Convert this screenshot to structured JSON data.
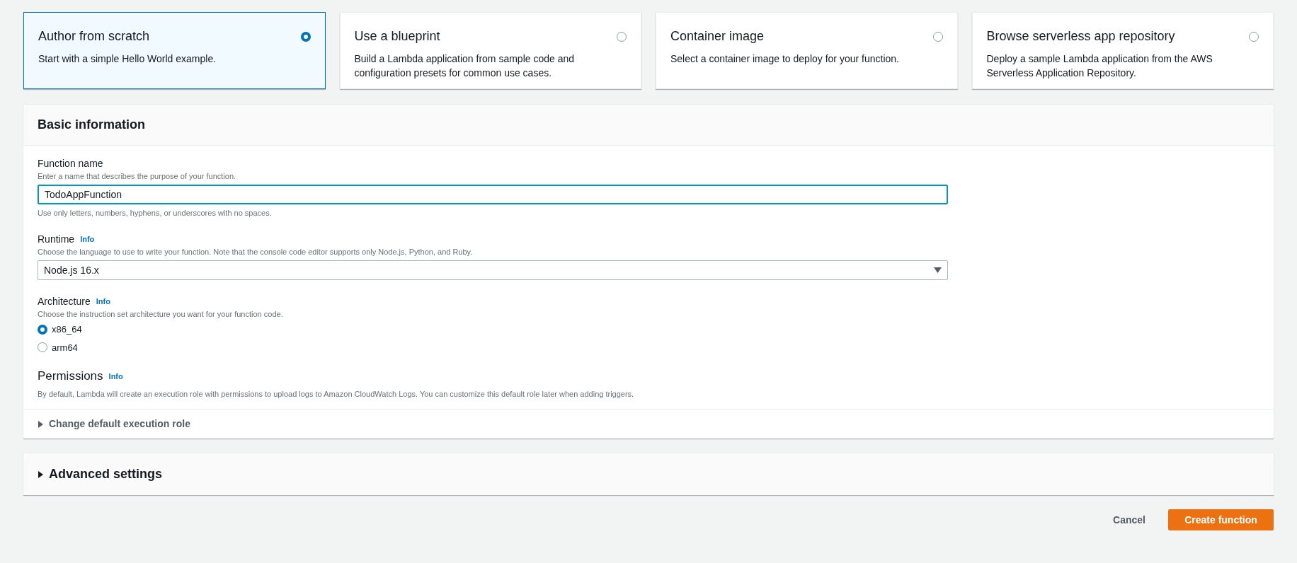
{
  "options": [
    {
      "title": "Author from scratch",
      "description": "Start with a simple Hello World example.",
      "selected": true
    },
    {
      "title": "Use a blueprint",
      "description": "Build a Lambda application from sample code and configuration presets for common use cases.",
      "selected": false
    },
    {
      "title": "Container image",
      "description": "Select a container image to deploy for your function.",
      "selected": false
    },
    {
      "title": "Browse serverless app repository",
      "description": "Deploy a sample Lambda application from the AWS Serverless Application Repository.",
      "selected": false
    }
  ],
  "basic_information": {
    "title": "Basic information",
    "function_name": {
      "label": "Function name",
      "description": "Enter a name that describes the purpose of your function.",
      "value": "TodoAppFunction",
      "hint": "Use only letters, numbers, hyphens, or underscores with no spaces."
    },
    "runtime": {
      "label": "Runtime",
      "info": "Info",
      "description": "Choose the language to use to write your function. Note that the console code editor supports only Node.js, Python, and Ruby.",
      "value": "Node.js 16.x"
    },
    "architecture": {
      "label": "Architecture",
      "info": "Info",
      "description": "Choose the instruction set architecture you want for your function code.",
      "choices": [
        {
          "label": "x86_64",
          "selected": true
        },
        {
          "label": "arm64",
          "selected": false
        }
      ]
    },
    "permissions": {
      "title": "Permissions",
      "info": "Info",
      "description": "By default, Lambda will create an execution role with permissions to upload logs to Amazon CloudWatch Logs. You can customize this default role later when adding triggers."
    },
    "execution_role": {
      "label": "Change default execution role",
      "expanded": false
    }
  },
  "advanced_settings": {
    "label": "Advanced settings",
    "expanded": false
  },
  "buttons": {
    "cancel": "Cancel",
    "create": "Create function"
  }
}
